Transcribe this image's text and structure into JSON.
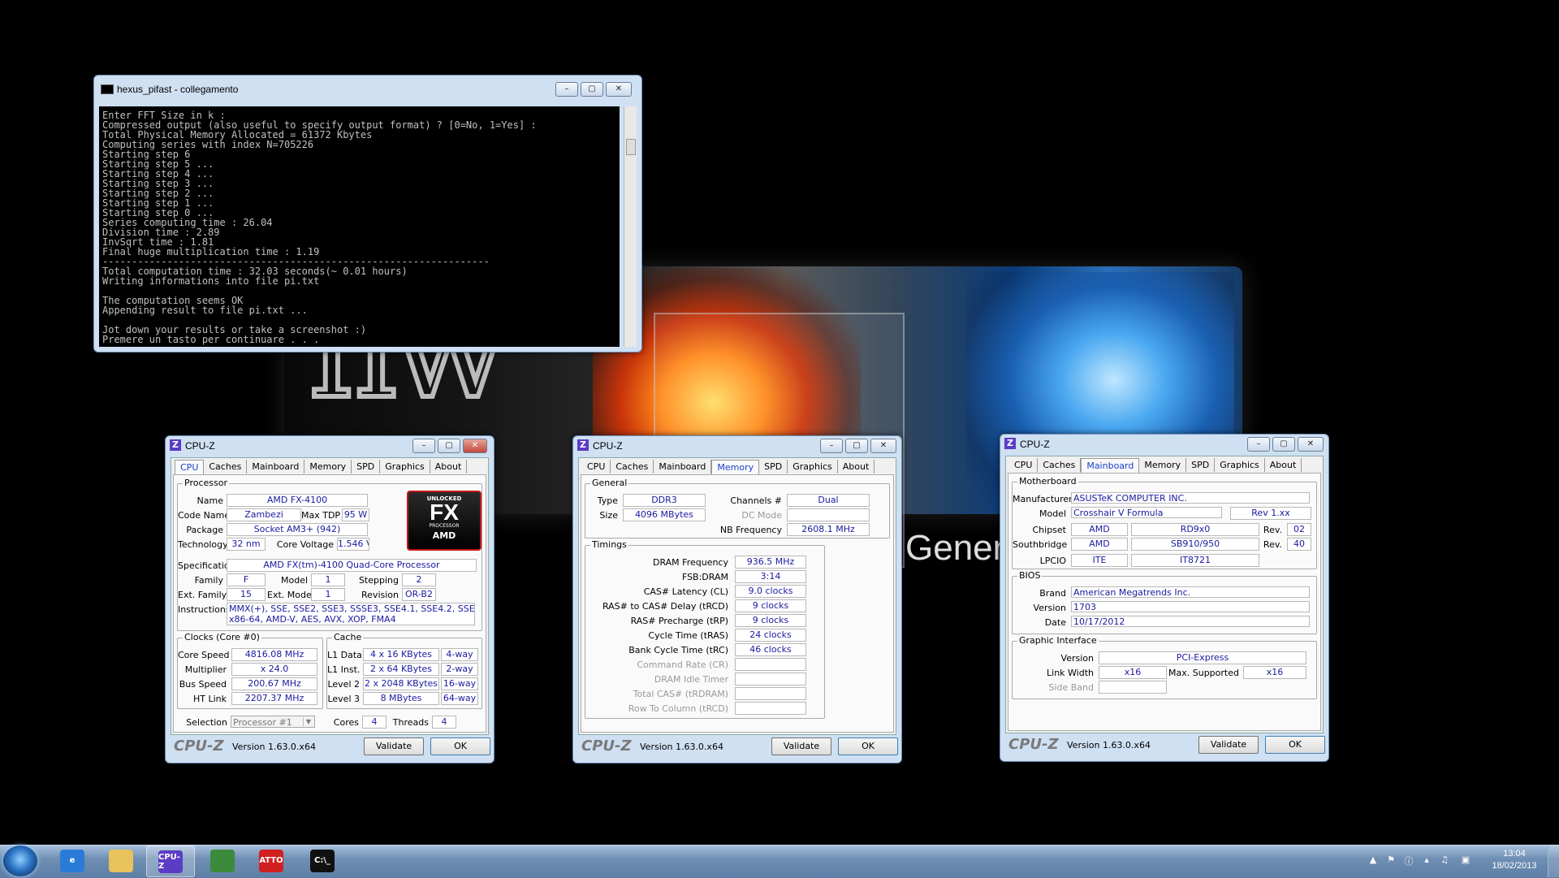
{
  "console": {
    "title": "hexus_pifast - collegamento",
    "lines": [
      "Enter FFT Size in k :",
      "Compressed output (also useful to specify output format) ? [0=No, 1=Yes] :",
      "Total Physical Memory Allocated = 61372 Kbytes",
      "Computing series with index N=705226",
      "Starting step 6",
      "Starting step 5 ...",
      "Starting step 4 ...",
      "Starting step 3 ...",
      "Starting step 2 ...",
      "Starting step 1 ...",
      "Starting step 0 ...",
      "Series computing time : 26.04",
      "Division time : 2.89",
      "InvSqrt time : 1.81",
      "Final huge multiplication time : 1.19",
      "------------------------------------------------------------------",
      "Total computation time : 32.03 seconds(~ 0.01 hours)",
      "Writing informations into file pi.txt",
      "",
      "The computation seems OK",
      "Appending result to file pi.txt ...",
      "",
      "Jot down your results or take a screenshot :)",
      "Premere un tasto per continuare . . ."
    ]
  },
  "cpuz_common": {
    "title": "CPU-Z",
    "tabs": [
      "CPU",
      "Caches",
      "Mainboard",
      "Memory",
      "SPD",
      "Graphics",
      "About"
    ],
    "logo": "CPU-Z",
    "version": "Version 1.63.0.x64",
    "validate": "Validate",
    "ok": "OK"
  },
  "cpu": {
    "processor_group": "Processor",
    "name_label": "Name",
    "name": "AMD FX-4100",
    "codename_label": "Code Name",
    "codename": "Zambezi",
    "maxtdp_label": "Max TDP",
    "maxtdp": "95 W",
    "package_label": "Package",
    "package": "Socket AM3+ (942)",
    "technology_label": "Technology",
    "technology": "32 nm",
    "corevoltage_label": "Core Voltage",
    "corevoltage": "1.546 V",
    "spec_label": "Specification",
    "spec": "AMD FX(tm)-4100 Quad-Core Processor",
    "family_label": "Family",
    "family": "F",
    "model_label": "Model",
    "model": "1",
    "stepping_label": "Stepping",
    "stepping": "2",
    "extfamily_label": "Ext. Family",
    "extfamily": "15",
    "extmodel_label": "Ext. Model",
    "extmodel": "1",
    "revision_label": "Revision",
    "revision": "OR-B2",
    "instructions_label": "Instructions",
    "instructions_1": "MMX(+), SSE, SSE2, SSE3, SSSE3, SSE4.1, SSE4.2, SSE4A,",
    "instructions_2": "x86-64, AMD-V, AES, AVX, XOP, FMA4",
    "clocks_group": "Clocks (Core #0)",
    "corespeed_label": "Core Speed",
    "corespeed": "4816.08 MHz",
    "multiplier_label": "Multiplier",
    "multiplier": "x 24.0",
    "busspeed_label": "Bus Speed",
    "busspeed": "200.67 MHz",
    "htlink_label": "HT Link",
    "htlink": "2207.37 MHz",
    "cache_group": "Cache",
    "l1d_label": "L1 Data",
    "l1d": "4 x 16 KBytes",
    "l1d_way": "4-way",
    "l1i_label": "L1 Inst.",
    "l1i": "2 x 64 KBytes",
    "l1i_way": "2-way",
    "l2_label": "Level 2",
    "l2": "2 x 2048 KBytes",
    "l2_way": "16-way",
    "l3_label": "Level 3",
    "l3": "8 MBytes",
    "l3_way": "64-way",
    "selection_label": "Selection",
    "selection": "Processor #1",
    "cores_label": "Cores",
    "cores": "4",
    "threads_label": "Threads",
    "threads": "4",
    "fx_logo": {
      "unlocked": "UNLOCKED",
      "fx": "FX",
      "processor": "PROCESSOR",
      "amd": "AMD"
    }
  },
  "memory": {
    "general_group": "General",
    "type_label": "Type",
    "type": "DDR3",
    "size_label": "Size",
    "size": "4096 MBytes",
    "channels_label": "Channels #",
    "channels": "Dual",
    "dcmode_label": "DC Mode",
    "dcmode": "",
    "nbfreq_label": "NB Frequency",
    "nbfreq": "2608.1 MHz",
    "timings_group": "Timings",
    "timings": [
      {
        "label": "DRAM Frequency",
        "value": "936.5 MHz",
        "disabled": false
      },
      {
        "label": "FSB:DRAM",
        "value": "3:14",
        "disabled": false
      },
      {
        "label": "CAS# Latency (CL)",
        "value": "9.0 clocks",
        "disabled": false
      },
      {
        "label": "RAS# to CAS# Delay (tRCD)",
        "value": "9 clocks",
        "disabled": false
      },
      {
        "label": "RAS# Precharge (tRP)",
        "value": "9 clocks",
        "disabled": false
      },
      {
        "label": "Cycle Time (tRAS)",
        "value": "24 clocks",
        "disabled": false
      },
      {
        "label": "Bank Cycle Time (tRC)",
        "value": "46 clocks",
        "disabled": false
      },
      {
        "label": "Command Rate (CR)",
        "value": "",
        "disabled": true
      },
      {
        "label": "DRAM Idle Timer",
        "value": "",
        "disabled": true
      },
      {
        "label": "Total CAS# (tRDRAM)",
        "value": "",
        "disabled": true
      },
      {
        "label": "Row To Column (tRCD)",
        "value": "",
        "disabled": true
      }
    ]
  },
  "mainboard": {
    "motherboard_group": "Motherboard",
    "manufacturer_label": "Manufacturer",
    "manufacturer": "ASUSTeK COMPUTER INC.",
    "model_label": "Model",
    "model": "Crosshair V Formula",
    "model_rev": "Rev 1.xx",
    "chipset_label": "Chipset",
    "chipset_vendor": "AMD",
    "chipset": "RD9x0",
    "chipset_rev_label": "Rev.",
    "chipset_rev": "02",
    "southbridge_label": "Southbridge",
    "sb_vendor": "AMD",
    "southbridge": "SB910/950",
    "sb_rev_label": "Rev.",
    "sb_rev": "40",
    "lpcio_label": "LPCIO",
    "lpcio_vendor": "ITE",
    "lpcio": "IT8721",
    "bios_group": "BIOS",
    "brand_label": "Brand",
    "brand": "American Megatrends Inc.",
    "version_label": "Version",
    "bios_version": "1703",
    "date_label": "Date",
    "date": "10/17/2012",
    "graphic_group": "Graphic Interface",
    "gi_version_label": "Version",
    "gi_version": "PCI-Express",
    "linkwidth_label": "Link Width",
    "linkwidth": "x16",
    "maxsupported_label": "Max. Supported",
    "maxsupported": "x16",
    "sideband_label": "Side Band",
    "sideband": ""
  },
  "wallpaper": {
    "hw": "hw",
    "gener": "Gener"
  },
  "taskbar": {
    "apps": [
      {
        "name": "internet-explorer",
        "label": "e",
        "color": "#2a7bd8"
      },
      {
        "name": "file-explorer",
        "label": "",
        "color": "#e8c25a"
      },
      {
        "name": "cpu-z",
        "label": "CPU-Z",
        "color": "#5b3cc4"
      },
      {
        "name": "gpu-tool",
        "label": "",
        "color": "#3c8a3c"
      },
      {
        "name": "atto",
        "label": "ATTO",
        "color": "#d02020"
      },
      {
        "name": "cmd",
        "label": "C:\\_",
        "color": "#111111"
      }
    ],
    "time": "13:04",
    "date": "18/02/2013"
  }
}
